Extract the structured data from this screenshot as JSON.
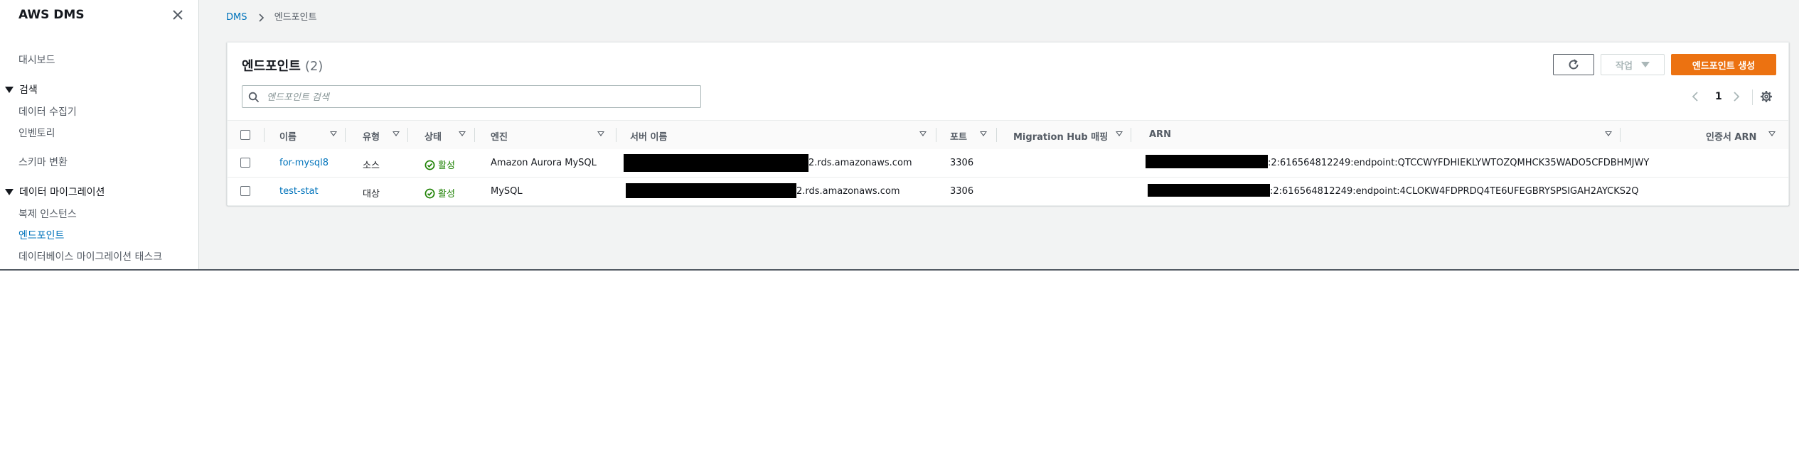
{
  "sidebar": {
    "title": "AWS DMS",
    "items": {
      "dashboard": "대시보드",
      "search_section": "검색",
      "data_collectors": "데이터 수집기",
      "inventory": "인벤토리",
      "schema_conversion": "스키마 변환",
      "migration_section": "데이터 마이그레이션",
      "replication_instances": "복제 인스턴스",
      "endpoints": "엔드포인트",
      "db_migration_tasks": "데이터베이스 마이그레이션 태스크"
    },
    "active_item": "엔드포인트"
  },
  "breadcrumb": {
    "root": "DMS",
    "current": "엔드포인트"
  },
  "panel": {
    "title": "엔드포인트",
    "count": "(2)",
    "actions_label": "작업",
    "create_label": "엔드포인트 생성",
    "search_placeholder": "엔드포인트 검색",
    "page": "1"
  },
  "table": {
    "columns": {
      "name": "이름",
      "type": "유형",
      "status": "상태",
      "engine": "엔진",
      "server": "서버 이름",
      "port": "포트",
      "migration_hub": "Migration Hub 매핑",
      "arn": "ARN",
      "cert_arn": "인증서 ARN"
    },
    "rows": [
      {
        "name": "for-mysql8",
        "type": "소스",
        "status": "활성",
        "engine": "Amazon Aurora MySQL",
        "server_suffix": "2.rds.amazonaws.com",
        "port": "3306",
        "migration_hub": "",
        "arn_suffix": ":2:616564812249:endpoint:QTCCWYFDHIEKLYWTOZQMHCK35WADO5CFDBHMJWY",
        "cert_arn": ""
      },
      {
        "name": "test-stat",
        "type": "대상",
        "status": "활성",
        "engine": "MySQL",
        "server_suffix": "2.rds.amazonaws.com",
        "port": "3306",
        "migration_hub": "",
        "arn_suffix": ":2:616564812249:endpoint:4CLOKW4FDPRDQ4TE6UFEGBRYSPSIGAH2AYCKS2Q",
        "cert_arn": ""
      }
    ]
  },
  "colors": {
    "accent": "#0073bb",
    "primary_button": "#ec7211",
    "status_ok": "#1d8102",
    "background": "#f2f3f3"
  },
  "icons": {
    "close": "close-icon",
    "refresh": "refresh-icon",
    "search": "search-icon",
    "settings": "gear-icon",
    "status": "check-circle-icon"
  }
}
